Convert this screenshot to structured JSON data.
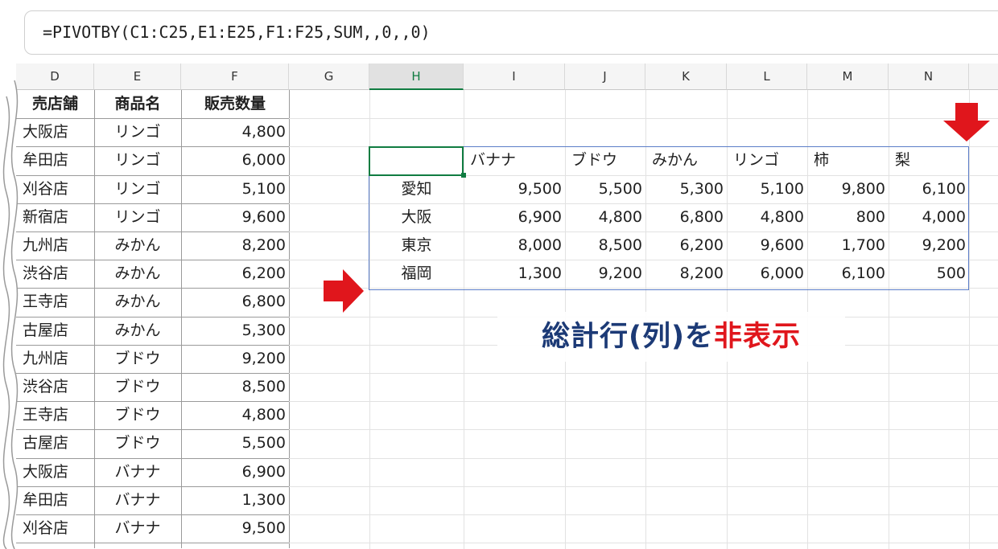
{
  "formula": "=PIVOTBY(C1:C25,E1:E25,F1:F25,SUM,,0,,0)",
  "columns": [
    "D",
    "E",
    "F",
    "G",
    "H",
    "I",
    "J",
    "K",
    "L",
    "M",
    "N"
  ],
  "source_headers": [
    "売店舗",
    "商品名",
    "販売数量"
  ],
  "source_rows": [
    [
      "大阪店",
      "リンゴ",
      "4,800"
    ],
    [
      "牟田店",
      "リンゴ",
      "6,000"
    ],
    [
      "刈谷店",
      "リンゴ",
      "5,100"
    ],
    [
      "新宿店",
      "リンゴ",
      "9,600"
    ],
    [
      "九州店",
      "みかん",
      "8,200"
    ],
    [
      "渋谷店",
      "みかん",
      "6,200"
    ],
    [
      "王寺店",
      "みかん",
      "6,800"
    ],
    [
      "古屋店",
      "みかん",
      "5,300"
    ],
    [
      "九州店",
      "ブドウ",
      "9,200"
    ],
    [
      "渋谷店",
      "ブドウ",
      "8,500"
    ],
    [
      "王寺店",
      "ブドウ",
      "4,800"
    ],
    [
      "古屋店",
      "ブドウ",
      "5,500"
    ],
    [
      "大阪店",
      "バナナ",
      "6,900"
    ],
    [
      "牟田店",
      "バナナ",
      "1,300"
    ],
    [
      "刈谷店",
      "バナナ",
      "9,500"
    ]
  ],
  "pivot": {
    "headers": [
      "バナナ",
      "ブドウ",
      "みかん",
      "リンゴ",
      "柿",
      "梨"
    ],
    "rows": [
      {
        "label": "愛知",
        "values": [
          "9,500",
          "5,500",
          "5,300",
          "5,100",
          "9,800",
          "6,100"
        ]
      },
      {
        "label": "大阪",
        "values": [
          "6,900",
          "4,800",
          "6,800",
          "4,800",
          "800",
          "4,000"
        ]
      },
      {
        "label": "東京",
        "values": [
          "8,000",
          "8,500",
          "6,200",
          "9,600",
          "1,700",
          "9,200"
        ]
      },
      {
        "label": "福岡",
        "values": [
          "1,300",
          "9,200",
          "8,200",
          "6,000",
          "6,100",
          "500"
        ]
      }
    ]
  },
  "banner": {
    "part1": "総計行(列)を",
    "part2": "非表示"
  },
  "colors": {
    "accent": "#107c41",
    "table_border": "#5b7dc8",
    "arrow": "#e0161c",
    "banner_text": "#1c3a76"
  }
}
